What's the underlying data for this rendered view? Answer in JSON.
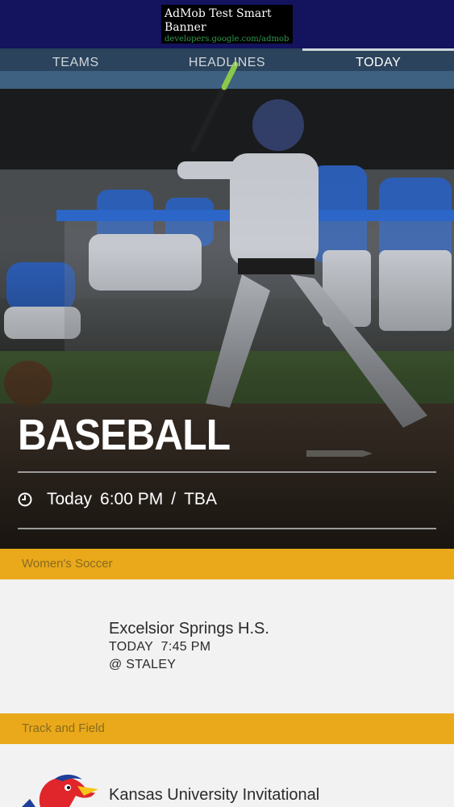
{
  "ad": {
    "title": "AdMob Test Smart Banner",
    "url": "developers.google.com/admob"
  },
  "tabs": [
    {
      "label": "TEAMS"
    },
    {
      "label": "HEADLINES"
    },
    {
      "label": "TODAY",
      "active": true
    }
  ],
  "hero": {
    "sport": "BASEBALL",
    "icon": "clock-icon",
    "day": "Today",
    "time": "6:00 PM",
    "separator": "/",
    "location": "TBA"
  },
  "events": [
    {
      "category": "Women's Soccer",
      "opponent": "Excelsior Springs H.S.",
      "day": "TODAY",
      "time": "7:45 PM",
      "venue": "@ STALEY"
    },
    {
      "category": "Track and Field",
      "opponent": "Kansas University Invitational",
      "logo": "jayhawk-logo"
    }
  ],
  "colors": {
    "ad_background": "#13135e",
    "section_header": "#e9a91a",
    "section_header_text": "#8a6a20",
    "card_background": "#f2f2f2"
  }
}
